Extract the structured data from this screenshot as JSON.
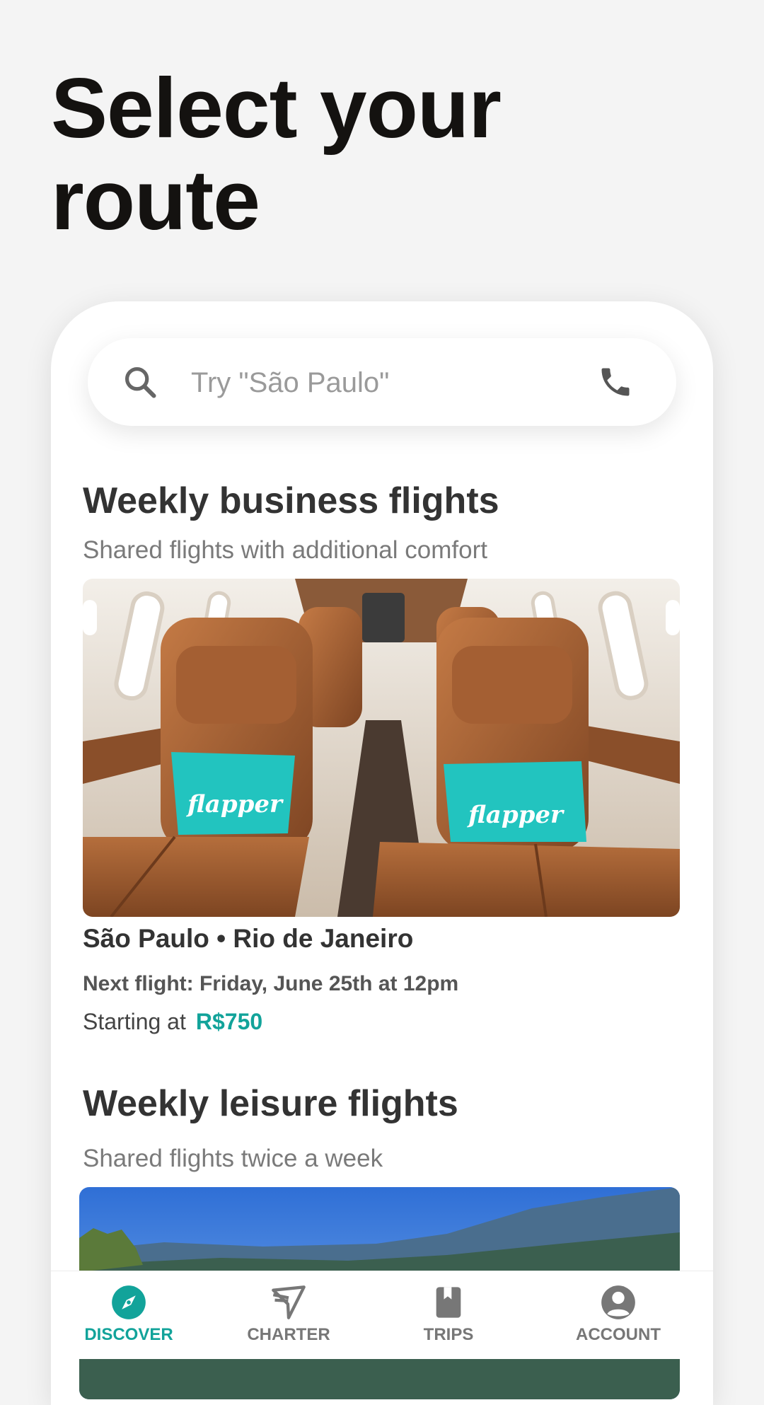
{
  "header": {
    "title": "Select your route"
  },
  "search": {
    "placeholder": "Try \"São Paulo\"",
    "value": ""
  },
  "sections": [
    {
      "title": "Weekly business flights",
      "subtitle": "Shared flights with additional comfort",
      "image_text": "flapper",
      "route": "São Paulo • Rio de Janeiro",
      "next_flight": "Next flight: Friday, June 25th at 12pm",
      "price_prefix": "Starting at",
      "price": "R$750"
    },
    {
      "title": "Weekly leisure flights",
      "subtitle": "Shared flights twice a week"
    }
  ],
  "bottom_nav": {
    "items": [
      {
        "label": "DISCOVER",
        "icon": "compass-icon",
        "active": true
      },
      {
        "label": "CHARTER",
        "icon": "plane-icon",
        "active": false
      },
      {
        "label": "TRIPS",
        "icon": "book-icon",
        "active": false
      },
      {
        "label": "ACCOUNT",
        "icon": "account-icon",
        "active": false
      }
    ]
  },
  "colors": {
    "accent": "#12a39a",
    "background": "#f4f4f4",
    "text": "#333333"
  }
}
